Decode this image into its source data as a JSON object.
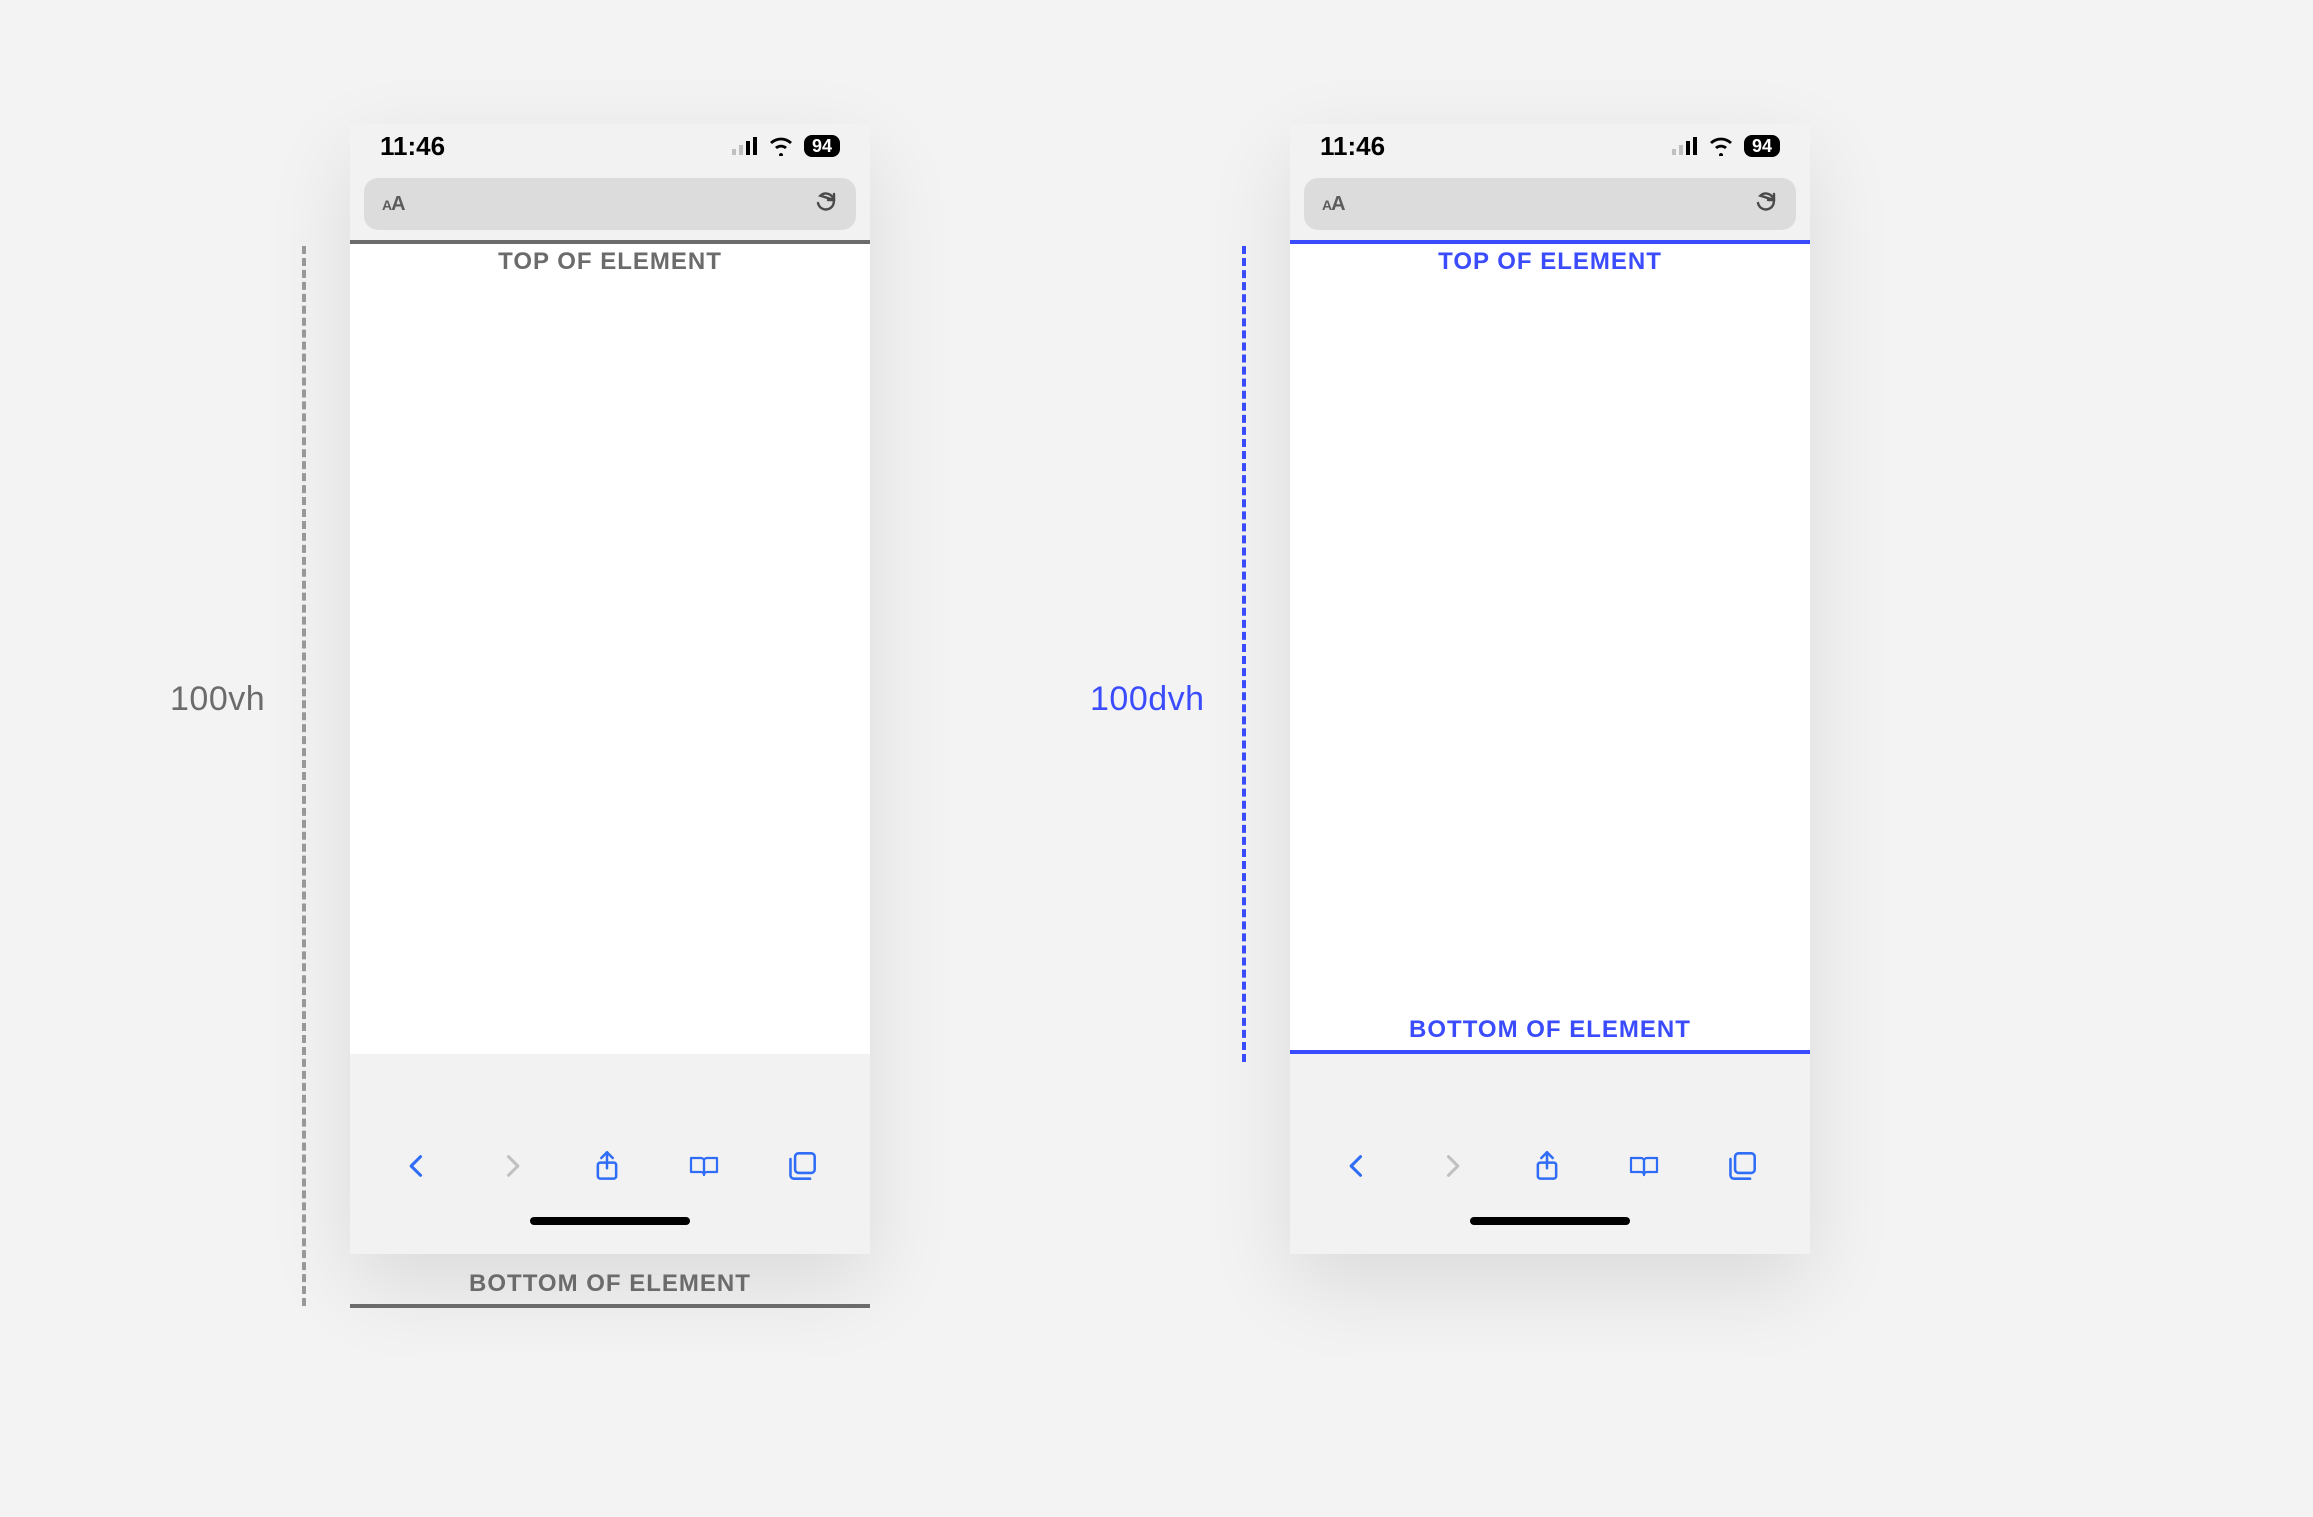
{
  "left": {
    "height_label": "100vh",
    "top_label": "TOP OF ELEMENT",
    "bottom_label": "BOTTOM OF ELEMENT",
    "color": "gray"
  },
  "right": {
    "height_label": "100dvh",
    "top_label": "TOP OF ELEMENT",
    "bottom_label": "BOTTOM OF ELEMENT",
    "color": "blue"
  },
  "statusbar": {
    "time": "11:46",
    "battery": "94"
  },
  "urlbar": {
    "reader": "AA"
  },
  "icons": {
    "signal": "signal-icon",
    "wifi": "wifi-icon",
    "battery": "battery-icon",
    "reader": "reader-mode-icon",
    "reload": "reload-icon",
    "back": "back-icon",
    "forward": "forward-icon",
    "share": "share-icon",
    "bookmarks": "bookmarks-icon",
    "tabs": "tabs-icon",
    "home": "home-indicator"
  }
}
